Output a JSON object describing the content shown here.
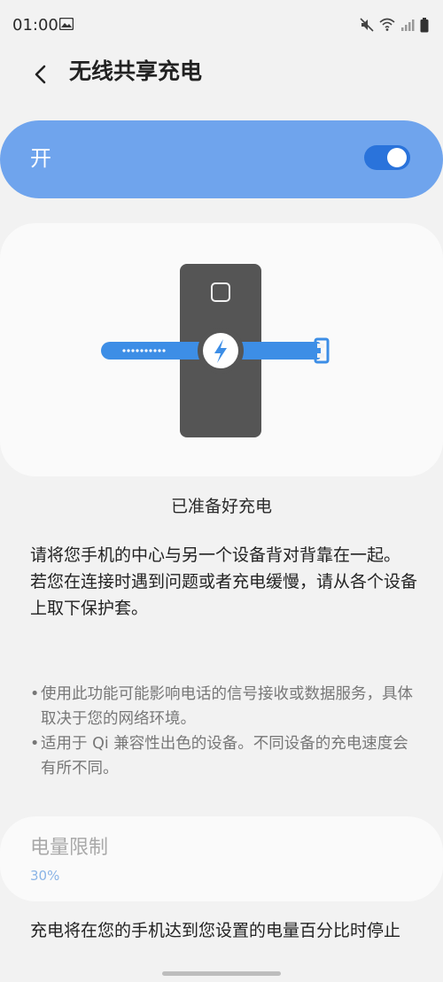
{
  "status_bar": {
    "time": "01:00",
    "icons": [
      "image-icon",
      "mute-icon",
      "wifi-icon",
      "signal-icon",
      "battery-icon"
    ]
  },
  "header": {
    "title": "无线共享充电",
    "back_icon": "chevron-left-icon"
  },
  "master_switch": {
    "label": "开",
    "state": "on",
    "accent_color": "#6fa4ed",
    "toggle_color": "#2a73db"
  },
  "illustration": {
    "description_icon": "lightning-bolt-icon",
    "strap_color": "#3d8ee6",
    "phone_color": "#555555"
  },
  "status_text": "已准备好充电",
  "instructions": [
    "请将您手机的中心与另一个设备背对背靠在一起。",
    "若您在连接时遇到问题或者充电缓慢，请从各个设备上取下保护套。"
  ],
  "notes": [
    "使用此功能可能影响电话的信号接收或数据服务，具体取决于您的网络环境。",
    "适用于 Qi 兼容性出色的设备。不同设备的充电速度会有所不同。"
  ],
  "battery_limit": {
    "title": "电量限制",
    "value": "30%"
  },
  "battery_limit_description": "充电将在您的手机达到您设置的电量百分比时停止"
}
